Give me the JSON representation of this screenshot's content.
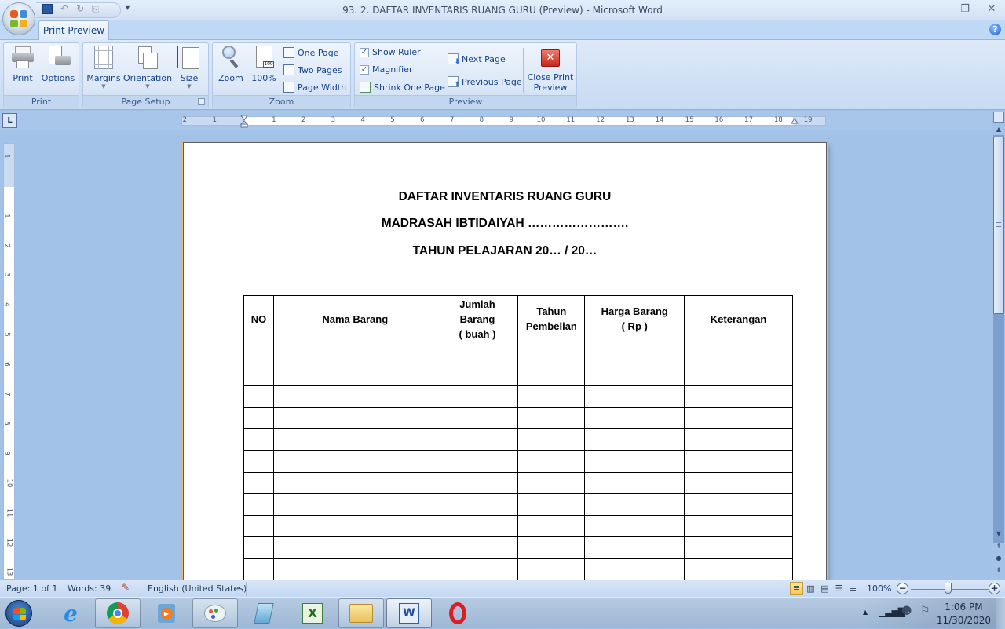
{
  "window": {
    "title": "93. 2. DAFTAR INVENTARIS RUANG GURU (Preview) - Microsoft Word",
    "minimize": "–",
    "restore": "❐",
    "close": "✕"
  },
  "quick_access": {
    "save": "save-icon",
    "undo": "undo-icon",
    "redo": "redo-icon",
    "more": "▾"
  },
  "ribbon": {
    "active_tab": "Print Preview",
    "groups": {
      "print": {
        "label": "Print",
        "print_button": "Print",
        "options_button": "Options"
      },
      "page_setup": {
        "label": "Page Setup",
        "margins_button": "Margins",
        "orientation_button": "Orientation",
        "size_button": "Size"
      },
      "zoom": {
        "label": "Zoom",
        "zoom_button": "Zoom",
        "hundred_button": "100%",
        "one_page": "One Page",
        "two_pages": "Two Pages",
        "page_width": "Page Width"
      },
      "preview": {
        "label": "Preview",
        "show_ruler": "Show Ruler",
        "show_ruler_checked": true,
        "magnifier": "Magnifier",
        "magnifier_checked": true,
        "shrink_one_page": "Shrink One Page",
        "next_page": "Next Page",
        "previous_page": "Previous Page",
        "close_preview": "Close Print Preview",
        "close_preview_line1": "Close Print",
        "close_preview_line2": "Preview"
      }
    }
  },
  "ruler": {
    "horizontal_labels": [
      "2",
      "1",
      "1",
      "2",
      "3",
      "4",
      "5",
      "6",
      "7",
      "8",
      "9",
      "10",
      "11",
      "12",
      "13",
      "14",
      "15",
      "16",
      "17",
      "18",
      "19"
    ],
    "vertical_labels": [
      "1",
      "1",
      "2",
      "3",
      "4",
      "5",
      "6",
      "7",
      "8",
      "9",
      "10",
      "11",
      "12",
      "13"
    ],
    "tab_selector": "L"
  },
  "document": {
    "title_line1": "DAFTAR INVENTARIS RUANG GURU",
    "title_line2": "MADRASAH IBTIDAIYAH …………………….",
    "title_line3": "TAHUN PELAJARAN 20… / 20…",
    "table": {
      "headers": [
        "NO",
        "Nama Barang",
        "Jumlah Barang ( buah )",
        "Tahun Pembelian",
        "Harga Barang ( Rp )",
        "Keterangan"
      ],
      "header_lines": [
        [
          "NO"
        ],
        [
          "Nama Barang"
        ],
        [
          "Jumlah",
          "Barang",
          "( buah )"
        ],
        [
          "Tahun",
          "Pembelian"
        ],
        [
          "Harga Barang",
          "( Rp )"
        ],
        [
          "Keterangan"
        ]
      ],
      "visible_empty_rows": 11
    }
  },
  "status_bar": {
    "page": "Page: 1 of 1",
    "words": "Words: 39",
    "language": "English (United States)",
    "zoom_level": "100%",
    "zoom_slider_fraction": 0.5,
    "views": [
      "Print Layout",
      "Full Screen Reading",
      "Web Layout",
      "Outline",
      "Draft"
    ],
    "active_view": "Print Layout"
  },
  "taskbar": {
    "apps": [
      "Internet Explorer",
      "Google Chrome",
      "Windows Media Player",
      "Paint",
      "Notepad",
      "Microsoft Excel",
      "Windows Explorer",
      "Microsoft Word",
      "Opera"
    ],
    "time": "1:06 PM",
    "date": "11/30/2020"
  }
}
